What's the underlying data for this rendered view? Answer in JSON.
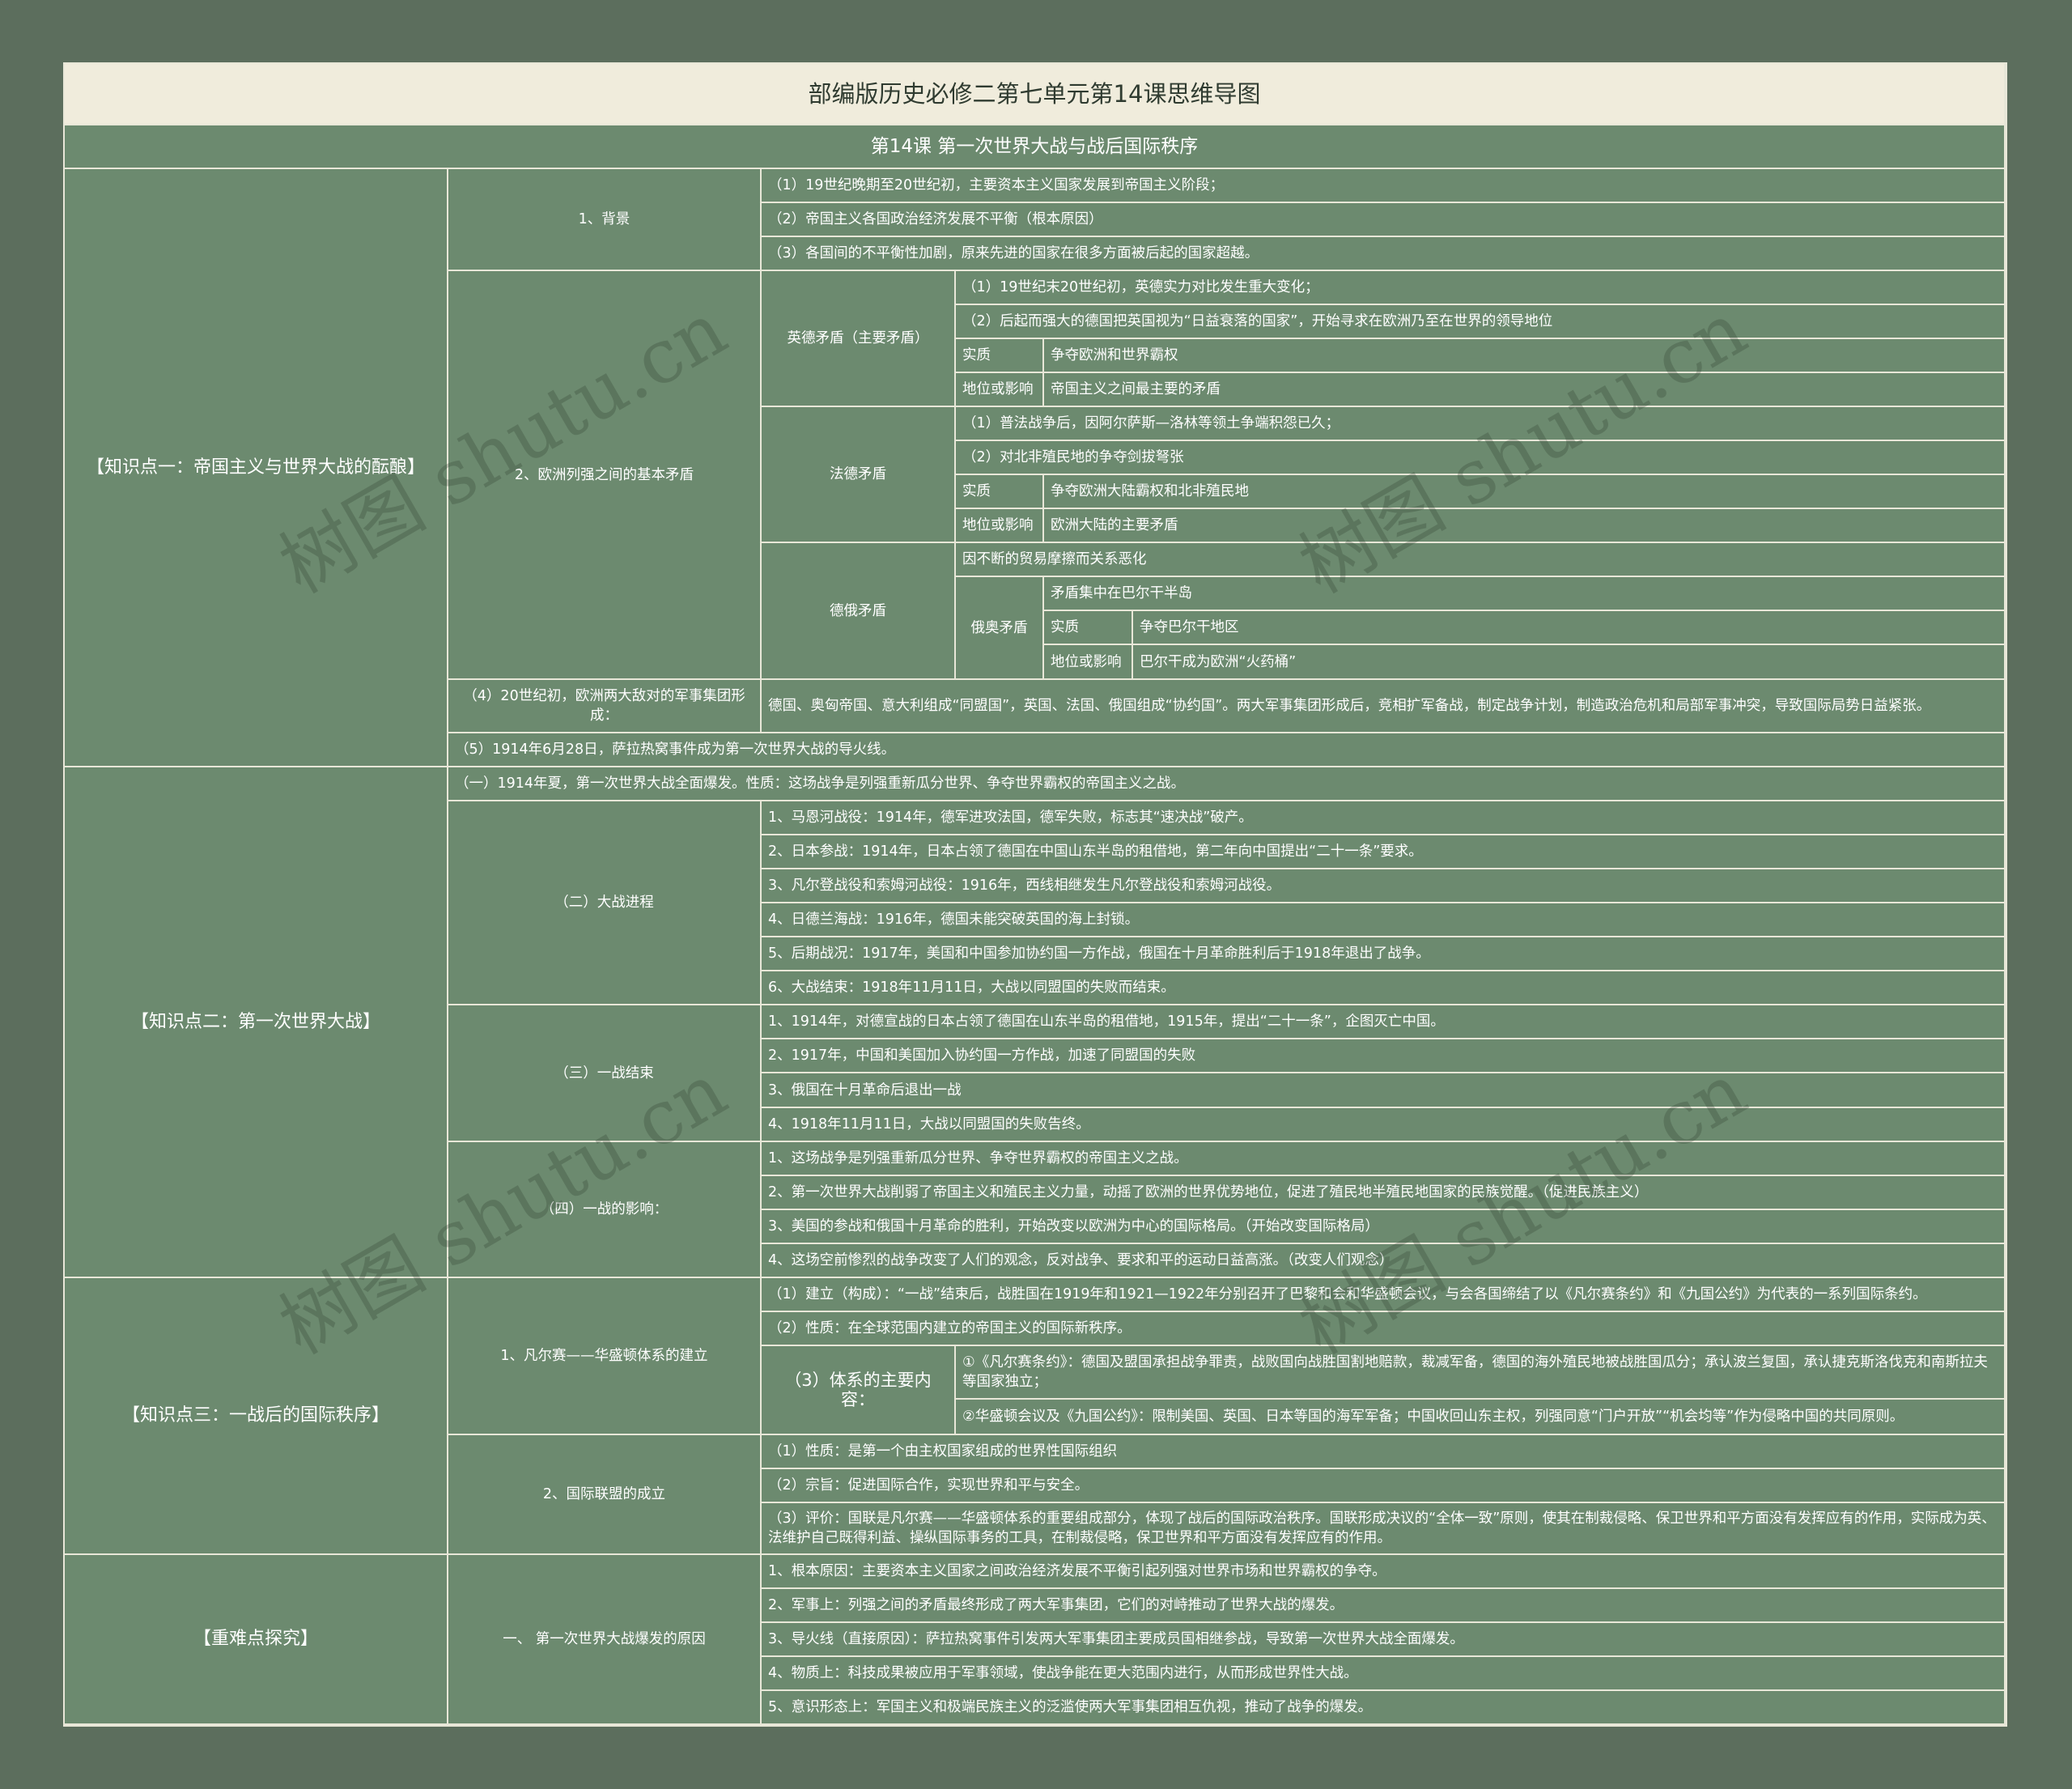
{
  "title": "部编版历史必修二第七单元第14课思维导图",
  "subtitle": "第14课  第一次世界大战与战后国际秩序",
  "watermark": "树图 shutu.cn",
  "kp1": {
    "label": "【知识点一：帝国主义与世界大战的酝酿】",
    "background": {
      "label": "1、背景",
      "items": [
        "（1）19世纪晚期至20世纪初，主要资本主义国家发展到帝国主义阶段；",
        "（2）帝国主义各国政治经济发展不平衡（根本原因）",
        "（3）各国间的不平衡性加剧，原来先进的国家在很多方面被后起的国家超越。"
      ]
    },
    "conflicts": {
      "label": "2、欧洲列强之间的基本矛盾",
      "anglo_german": {
        "label": "英德矛盾（主要矛盾）",
        "items": [
          "（1）19世纪末20世纪初，英德实力对比发生重大变化；",
          "（2）后起而强大的德国把英国视为“日益衰落的国家”，开始寻求在欧洲乃至在世界的领导地位"
        ],
        "essence_key": "实质",
        "essence_val": "争夺欧洲和世界霸权",
        "impact_key": "地位或影响",
        "impact_val": "帝国主义之间最主要的矛盾"
      },
      "franco_german": {
        "label": "法德矛盾",
        "items": [
          "（1）普法战争后，因阿尔萨斯—洛林等领土争端积怨已久；",
          "（2）对北非殖民地的争夺剑拔弩张"
        ],
        "essence_key": "实质",
        "essence_val": "争夺欧洲大陆霸权和北非殖民地",
        "impact_key": "地位或影响",
        "impact_val": "欧洲大陆的主要矛盾"
      },
      "russo_german": {
        "label": "德俄矛盾",
        "item": "因不断的贸易摩擦而关系恶化",
        "austro_russian": {
          "label": "俄奥矛盾",
          "item": "矛盾集中在巴尔干半岛",
          "essence_key": "实质",
          "essence_val": "争夺巴尔干地区",
          "impact_key": "地位或影响",
          "impact_val": "巴尔干成为欧洲“火药桶”"
        }
      }
    },
    "blocs": {
      "label": "（4）20世纪初，欧洲两大敌对的军事集团形成：",
      "text": "德国、奥匈帝国、意大利组成“同盟国”，英国、法国、俄国组成“协约国”。两大军事集团形成后，竞相扩军备战，制定战争计划，制造政治危机和局部军事冲突，导致国际局势日益紧张。"
    },
    "fuse": "（5）1914年6月28日，萨拉热窝事件成为第一次世界大战的导火线。"
  },
  "kp2": {
    "label": "【知识点二：第一次世界大战】",
    "outbreak": "（一）1914年夏，第一次世界大战全面爆发。性质：这场战争是列强重新瓜分世界、争夺世界霸权的帝国主义之战。",
    "progress": {
      "label": "（二）大战进程",
      "items": [
        "1、马恩河战役：1914年，德军进攻法国，德军失败，标志其“速决战”破产。",
        "2、日本参战：1914年，日本占领了德国在中国山东半岛的租借地，第二年向中国提出“二十一条”要求。",
        "3、凡尔登战役和索姆河战役：1916年，西线相继发生凡尔登战役和索姆河战役。",
        "4、日德兰海战：1916年，德国未能突破英国的海上封锁。",
        "5、后期战况：1917年，美国和中国参加协约国一方作战，俄国在十月革命胜利后于1918年退出了战争。",
        "6、大战结束：1918年11月11日，大战以同盟国的失败而结束。"
      ]
    },
    "end": {
      "label": "（三）一战结束",
      "items": [
        "1、1914年，对德宣战的日本占领了德国在山东半岛的租借地，1915年，提出“二十一条”，企图灭亡中国。",
        "2、1917年，中国和美国加入协约国一方作战，加速了同盟国的失败",
        "3、俄国在十月革命后退出一战",
        "4、1918年11月11日，大战以同盟国的失败告终。"
      ]
    },
    "influence": {
      "label": "（四）一战的影响：",
      "items": [
        "1、这场战争是列强重新瓜分世界、争夺世界霸权的帝国主义之战。",
        "2、第一次世界大战削弱了帝国主义和殖民主义力量，动摇了欧洲的世界优势地位，促进了殖民地半殖民地国家的民族觉醒。（促进民族主义）",
        "3、美国的参战和俄国十月革命的胜利，开始改变以欧洲为中心的国际格局。（开始改变国际格局）",
        "4、这场空前惨烈的战争改变了人们的观念，反对战争、要求和平的运动日益高涨。（改变人们观念）"
      ]
    }
  },
  "kp3": {
    "label": "【知识点三：一战后的国际秩序】",
    "versailles": {
      "label": "1、凡尔赛——华盛顿体系的建立",
      "items": [
        "（1）建立（构成）：“一战”结束后，战胜国在1919年和1921—1922年分别召开了巴黎和会和华盛顿会议，与会各国缔结了以《凡尔赛条约》和《九国公约》为代表的一系列国际条约。",
        "（2）性质：在全球范围内建立的帝国主义的国际新秩序。"
      ],
      "content_label": "（3）体系的主要内容：",
      "content_items": [
        "①《凡尔赛条约》：德国及盟国承担战争罪责，战败国向战胜国割地赔款，裁减军备，德国的海外殖民地被战胜国瓜分；承认波兰复国，承认捷克斯洛伐克和南斯拉夫等国家独立；",
        "②华盛顿会议及《九国公约》：限制美国、英国、日本等国的海军军备；中国收回山东主权，列强同意“门户开放”“机会均等”作为侵略中国的共同原则。"
      ]
    },
    "league": {
      "label": "2、国际联盟的成立",
      "items": [
        "（1）性质：是第一个由主权国家组成的世界性国际组织",
        "（2）宗旨：促进国际合作，实现世界和平与安全。",
        "（3）评价：国联是凡尔赛——华盛顿体系的重要组成部分，体现了战后的国际政治秩序。国联形成决议的“全体一致”原则，使其在制裁侵略、保卫世界和平方面没有发挥应有的作用，实际成为英、法维护自己既得利益、操纵国际事务的工具，在制裁侵略，保卫世界和平方面没有发挥应有的作用。"
      ]
    }
  },
  "focus": {
    "label": "【重难点探究】",
    "causes": {
      "label": "一、 第一次世界大战爆发的原因",
      "items": [
        "1、根本原因：主要资本主义国家之间政治经济发展不平衡引起列强对世界市场和世界霸权的争夺。",
        "2、军事上：列强之间的矛盾最终形成了两大军事集团，它们的对峙推动了世界大战的爆发。",
        "3、导火线（直接原因）：萨拉热窝事件引发两大军事集团主要成员国相继参战，导致第一次世界大战全面爆发。",
        "4、物质上：科技成果被应用于军事领域，使战争能在更大范围内进行，从而形成世界性大战。",
        "5、意识形态上：军国主义和极端民族主义的泛滥使两大军事集团相互仇视，推动了战争的爆发。"
      ]
    }
  }
}
